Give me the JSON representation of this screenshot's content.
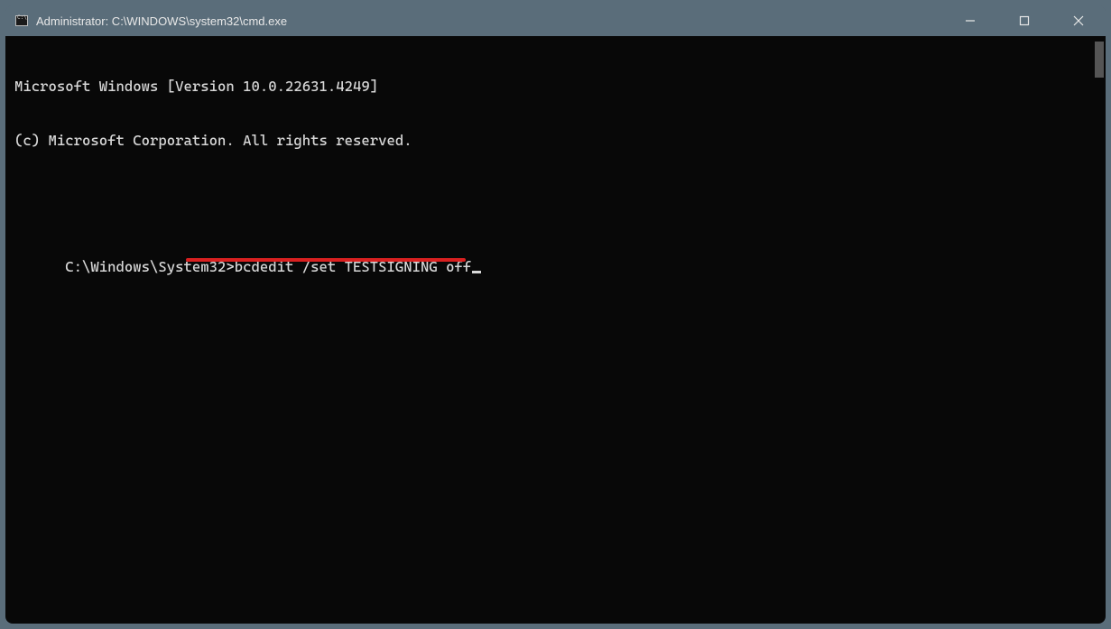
{
  "window": {
    "title": "Administrator: C:\\WINDOWS\\system32\\cmd.exe"
  },
  "terminal": {
    "line1": "Microsoft Windows [Version 10.0.22631.4249]",
    "line2": "(c) Microsoft Corporation. All rights reserved.",
    "prompt": "C:\\Windows\\System32>",
    "command": "bcdedit /set TESTSIGNING off"
  },
  "annotation": {
    "underline_color": "#d92020"
  }
}
